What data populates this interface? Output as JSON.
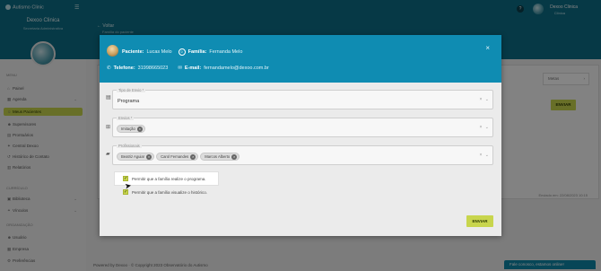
{
  "app": {
    "logo": "Autismo Clinic",
    "sidebar": {
      "org_name": "Dexoo Clinica",
      "org_sub": "Secretaria Administrativa",
      "section_main": "MENU",
      "items": [
        {
          "label": "Painel",
          "icon": "home-icon"
        },
        {
          "label": "Agenda",
          "icon": "calendar-icon"
        },
        {
          "label": "Meus Pacientes",
          "icon": "people-icon",
          "active": true
        },
        {
          "label": "Supervisores",
          "icon": "user-icon"
        },
        {
          "label": "Prontuários",
          "icon": "file-icon"
        },
        {
          "label": "Central Dexoo",
          "icon": "star-icon"
        },
        {
          "label": "Histórico de Contato",
          "icon": "history-icon"
        },
        {
          "label": "Relatórios",
          "icon": "report-icon"
        }
      ],
      "section_library": "CURRÍCULO",
      "items2": [
        {
          "label": "Biblioteca",
          "icon": "book-icon"
        },
        {
          "label": "Vínculos",
          "icon": "link-icon"
        }
      ],
      "section_org": "ORGANIZAÇÃO",
      "items3": [
        {
          "label": "Usuário",
          "icon": "user-icon"
        },
        {
          "label": "Empresa",
          "icon": "building-icon"
        },
        {
          "label": "Preferências",
          "icon": "gear-icon"
        }
      ]
    },
    "topbar": {
      "help": "?",
      "user_name": "Dexoo Clinica",
      "user_role": "Clínica"
    },
    "subhead": {
      "back": "Voltar",
      "crumb": "Família do paciente"
    },
    "bg": {
      "tab_label": "Metas",
      "enviar": "ENVIAR",
      "date": "Enviado em: 22/08/2023 10:15"
    },
    "footer": {
      "text": "Powered by Dexoo · © Copyright 2023 Observatório do Autismo",
      "chat": "Fale conosco, estamos online!"
    }
  },
  "modal": {
    "patient_label": "Paciente:",
    "patient_value": "Lucas Melo",
    "family_label": "Família:",
    "family_value": "Fernanda Melo",
    "phone_label": "Telefone:",
    "phone_value": "31998665023",
    "email_label": "E-mail:",
    "email_value": "fernandamelo@dexoo.com.br",
    "close": "×",
    "fields": [
      {
        "legend": "Tipo de Envio *",
        "value": "Programa",
        "icon": "document-icon"
      },
      {
        "legend": "Envios *",
        "chips": [
          "Imitação"
        ],
        "icon": "add-box-icon"
      },
      {
        "legend": "Profissionais",
        "chips": [
          "Beatriz Aguiar",
          "Carol Fernandes",
          "Marcos Alberto"
        ],
        "icon": "briefcase-icon"
      }
    ],
    "checkbox1": "Permitir que a família realize o programa.",
    "checkbox2": "Permitir que a família visualize o histórico.",
    "submit": "ENVIAR"
  },
  "colors": {
    "primary": "#0f8cb2",
    "accent": "#c8d54d",
    "dark_teal": "#0d6e86"
  }
}
